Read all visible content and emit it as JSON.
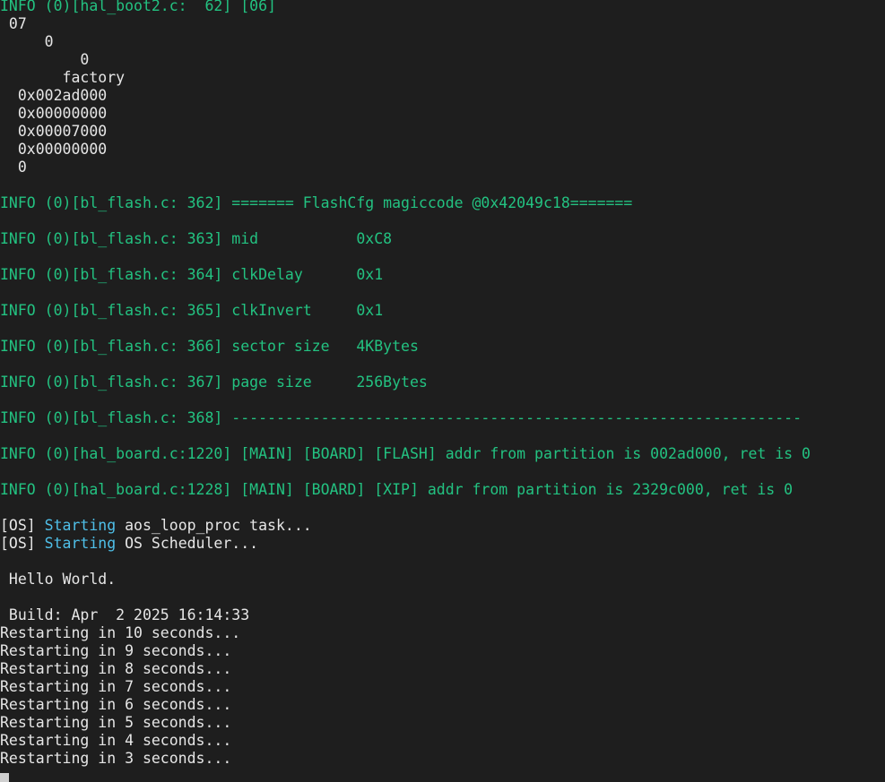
{
  "terminal": {
    "lines": [
      {
        "segs": [
          {
            "t": "INFO (0)[hal_boot2.c:  62] [06]",
            "c": "g"
          }
        ]
      },
      {
        "segs": [
          {
            "t": " 07",
            "c": "w"
          }
        ]
      },
      {
        "segs": [
          {
            "t": "     0",
            "c": "w"
          }
        ]
      },
      {
        "segs": [
          {
            "t": "         0",
            "c": "w"
          }
        ]
      },
      {
        "segs": [
          {
            "t": "       factory",
            "c": "w"
          }
        ]
      },
      {
        "segs": [
          {
            "t": "  0x002ad000",
            "c": "w"
          }
        ]
      },
      {
        "segs": [
          {
            "t": "  0x00000000",
            "c": "w"
          }
        ]
      },
      {
        "segs": [
          {
            "t": "  0x00007000",
            "c": "w"
          }
        ]
      },
      {
        "segs": [
          {
            "t": "  0x00000000",
            "c": "w"
          }
        ]
      },
      {
        "segs": [
          {
            "t": "  0",
            "c": "w"
          }
        ]
      },
      {
        "segs": []
      },
      {
        "segs": [
          {
            "t": "INFO (0)[bl_flash.c: 362] ======= FlashCfg magiccode @0x42049c18=======",
            "c": "g"
          }
        ]
      },
      {
        "segs": []
      },
      {
        "segs": [
          {
            "t": "INFO (0)[bl_flash.c: 363] mid           0xC8",
            "c": "g"
          }
        ]
      },
      {
        "segs": []
      },
      {
        "segs": [
          {
            "t": "INFO (0)[bl_flash.c: 364] clkDelay      0x1",
            "c": "g"
          }
        ]
      },
      {
        "segs": []
      },
      {
        "segs": [
          {
            "t": "INFO (0)[bl_flash.c: 365] clkInvert     0x1",
            "c": "g"
          }
        ]
      },
      {
        "segs": []
      },
      {
        "segs": [
          {
            "t": "INFO (0)[bl_flash.c: 366] sector size   4KBytes",
            "c": "g"
          }
        ]
      },
      {
        "segs": []
      },
      {
        "segs": [
          {
            "t": "INFO (0)[bl_flash.c: 367] page size     256Bytes",
            "c": "g"
          }
        ]
      },
      {
        "segs": []
      },
      {
        "segs": [
          {
            "t": "INFO (0)[bl_flash.c: 368] ----------------------------------------------------------------",
            "c": "g"
          }
        ]
      },
      {
        "segs": []
      },
      {
        "segs": [
          {
            "t": "INFO (0)[hal_board.c:1220] [MAIN] [BOARD] [FLASH] addr from partition is 002ad000, ret is 0",
            "c": "g"
          }
        ]
      },
      {
        "segs": []
      },
      {
        "segs": [
          {
            "t": "INFO (0)[hal_board.c:1228] [MAIN] [BOARD] [XIP] addr from partition is 2329c000, ret is 0",
            "c": "g"
          }
        ]
      },
      {
        "segs": []
      },
      {
        "segs": [
          {
            "t": "[OS] ",
            "c": "w"
          },
          {
            "t": "Starting",
            "c": "c"
          },
          {
            "t": " aos_loop_proc task...",
            "c": "w"
          }
        ]
      },
      {
        "segs": [
          {
            "t": "[OS] ",
            "c": "w"
          },
          {
            "t": "Starting",
            "c": "c"
          },
          {
            "t": " OS Scheduler...",
            "c": "w"
          }
        ]
      },
      {
        "segs": []
      },
      {
        "segs": [
          {
            "t": " Hello World.",
            "c": "w"
          }
        ]
      },
      {
        "segs": []
      },
      {
        "segs": [
          {
            "t": " Build: Apr  2 2025 16:14:33",
            "c": "w"
          }
        ]
      },
      {
        "segs": [
          {
            "t": "Restarting in 10 seconds...",
            "c": "w"
          }
        ]
      },
      {
        "segs": [
          {
            "t": "Restarting in 9 seconds...",
            "c": "w"
          }
        ]
      },
      {
        "segs": [
          {
            "t": "Restarting in 8 seconds...",
            "c": "w"
          }
        ]
      },
      {
        "segs": [
          {
            "t": "Restarting in 7 seconds...",
            "c": "w"
          }
        ]
      },
      {
        "segs": [
          {
            "t": "Restarting in 6 seconds...",
            "c": "w"
          }
        ]
      },
      {
        "segs": [
          {
            "t": "Restarting in 5 seconds...",
            "c": "w"
          }
        ]
      },
      {
        "segs": [
          {
            "t": "Restarting in 4 seconds...",
            "c": "w"
          }
        ]
      },
      {
        "segs": [
          {
            "t": "Restarting in 3 seconds...",
            "c": "w"
          }
        ]
      }
    ]
  },
  "colors": {
    "background": "#1e1e1e",
    "info_text": "#23c281",
    "starting_keyword": "#4fbfe8",
    "default_text": "#e6e6e6",
    "cursor": "#cfcfcf"
  }
}
